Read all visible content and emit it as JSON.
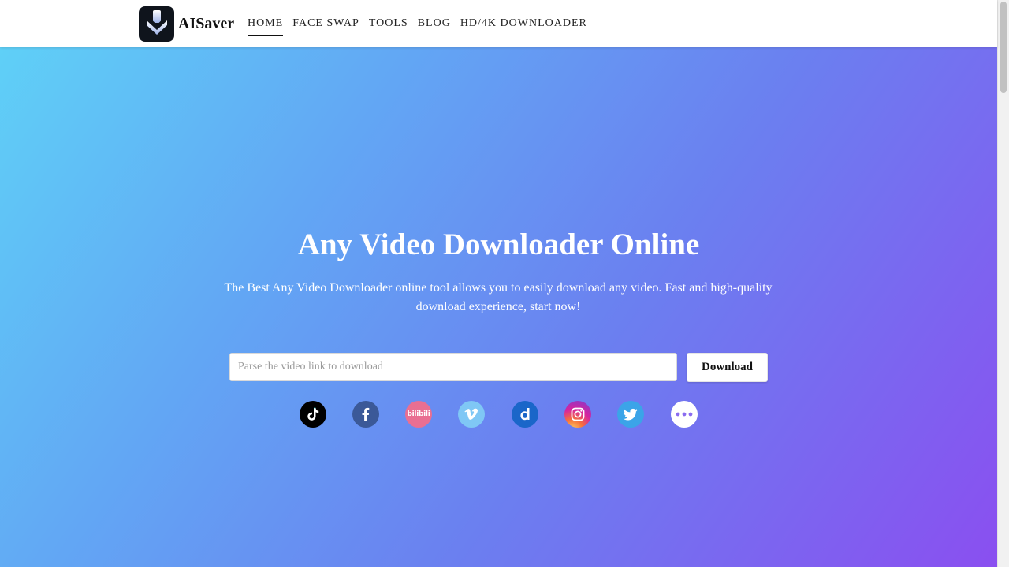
{
  "brand": {
    "name": "AISaver"
  },
  "nav": {
    "items": [
      {
        "label": "HOME",
        "active": true
      },
      {
        "label": "FACE SWAP",
        "active": false
      },
      {
        "label": "TOOLS",
        "active": false
      },
      {
        "label": "BLOG",
        "active": false
      },
      {
        "label": "HD/4K DOWNLOADER",
        "active": false
      }
    ]
  },
  "hero": {
    "title": "Any Video Downloader Online",
    "subtitle": "The Best Any Video Downloader online tool allows you to easily download any video. Fast and high-quality download experience, start now!",
    "search_placeholder": "Parse the video link to download",
    "search_value": "",
    "download_label": "Download"
  },
  "platforms": [
    {
      "name": "tiktok",
      "icon": "tiktok-icon",
      "color": "#000000"
    },
    {
      "name": "facebook",
      "icon": "facebook-icon",
      "color": "#3b5998"
    },
    {
      "name": "bilibili",
      "icon": "bilibili-icon",
      "color": "#e96f92",
      "text": "bilibili"
    },
    {
      "name": "vimeo",
      "icon": "vimeo-icon",
      "color": "#7fc7f5"
    },
    {
      "name": "dailymotion",
      "icon": "dailymotion-icon",
      "color": "#1a66c9"
    },
    {
      "name": "instagram",
      "icon": "instagram-icon",
      "color": "#d6249f"
    },
    {
      "name": "twitter",
      "icon": "twitter-icon",
      "color": "#3ba4e8"
    },
    {
      "name": "more",
      "icon": "more-icon",
      "color": "#ffffff"
    }
  ],
  "colors": {
    "gradient_start": "#5fd0f7",
    "gradient_end": "#8a4ff0",
    "header_bg": "#ffffff"
  }
}
